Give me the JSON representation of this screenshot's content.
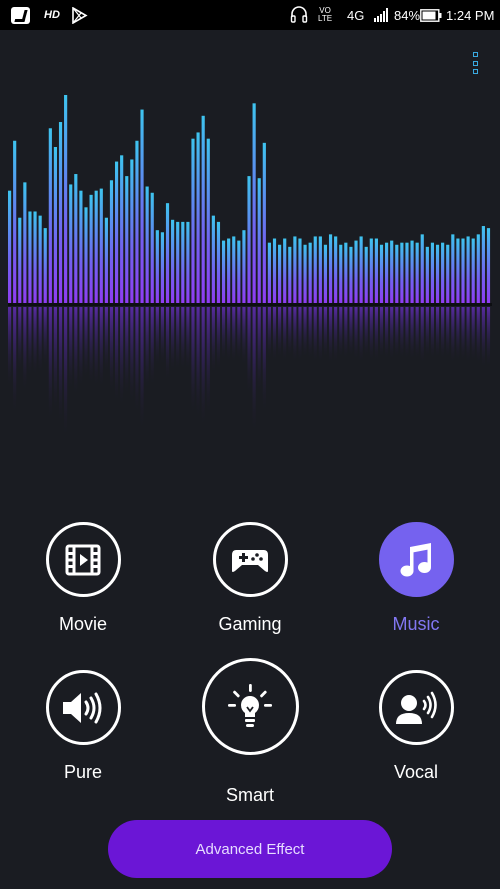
{
  "status_bar": {
    "app_icon": "app-icon",
    "hd_label": "HD",
    "volte_top": "VO",
    "volte_bottom": "LTE",
    "network": "4G",
    "battery_percent": "84%",
    "time": "1:24 PM"
  },
  "visualizer": {
    "levels": [
      0.54,
      0.78,
      0.41,
      0.58,
      0.44,
      0.44,
      0.42,
      0.36,
      0.84,
      0.75,
      0.87,
      1.0,
      0.57,
      0.62,
      0.54,
      0.46,
      0.52,
      0.54,
      0.55,
      0.41,
      0.59,
      0.68,
      0.71,
      0.61,
      0.69,
      0.78,
      0.93,
      0.56,
      0.53,
      0.35,
      0.34,
      0.48,
      0.4,
      0.39,
      0.39,
      0.39,
      0.79,
      0.82,
      0.9,
      0.79,
      0.42,
      0.39,
      0.3,
      0.31,
      0.32,
      0.3,
      0.35,
      0.61,
      0.96,
      0.6,
      0.77,
      0.29,
      0.31,
      0.28,
      0.31,
      0.27,
      0.32,
      0.31,
      0.28,
      0.29,
      0.32,
      0.32,
      0.28,
      0.33,
      0.32,
      0.28,
      0.29,
      0.27,
      0.3,
      0.32,
      0.27,
      0.31,
      0.31,
      0.28,
      0.29,
      0.3,
      0.28,
      0.29,
      0.29,
      0.3,
      0.29,
      0.33,
      0.27,
      0.29,
      0.28,
      0.29,
      0.28,
      0.33,
      0.31,
      0.31,
      0.32,
      0.31,
      0.33,
      0.37,
      0.36
    ]
  },
  "colors": {
    "bar_top": "#3ec4ef",
    "bar_bottom": "#8f3cf3",
    "accent": "#7562ef",
    "button": "#6b16d6"
  },
  "modes": {
    "movie": "Movie",
    "gaming": "Gaming",
    "music": "Music",
    "pure": "Pure",
    "smart": "Smart",
    "vocal": "Vocal",
    "active": "Music"
  },
  "advanced_button_label": "Advanced Effect"
}
